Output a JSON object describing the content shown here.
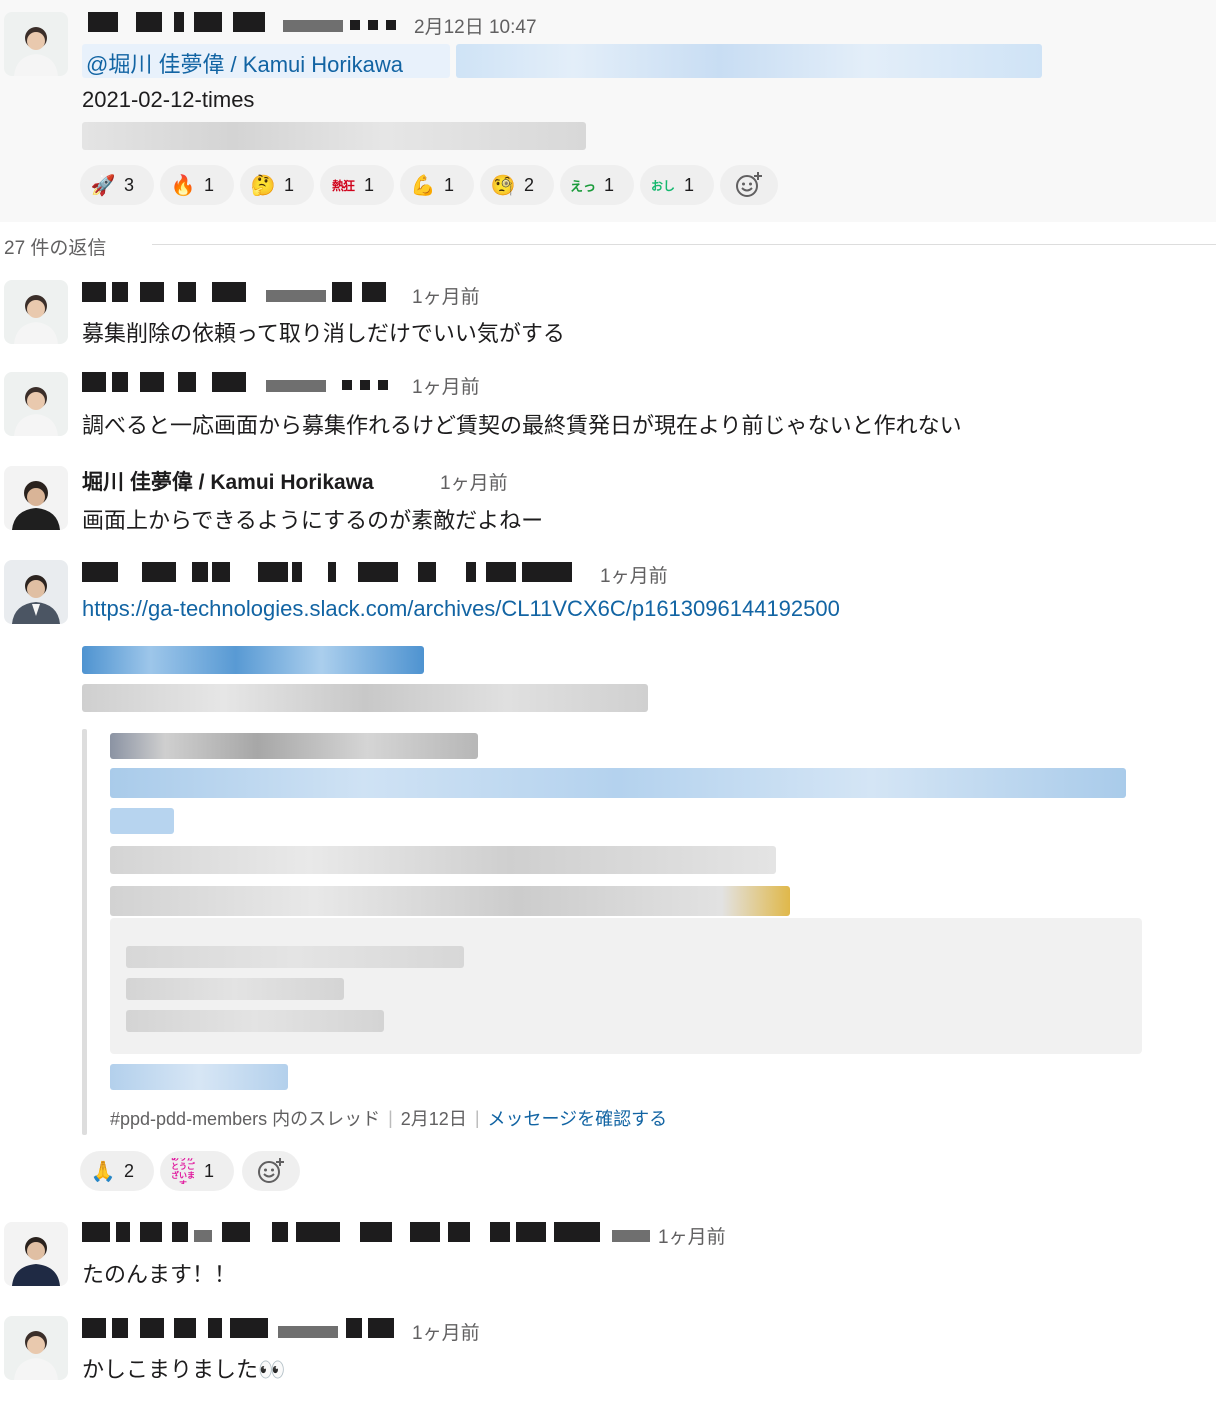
{
  "parent": {
    "timestamp": "2月12日 10:47",
    "mention": "@堀川 佳夢偉 / Kamui Horikawa",
    "title": "2021-02-12-times",
    "reactions": [
      {
        "emoji": "🚀",
        "count": "3"
      },
      {
        "emoji": "🔥",
        "count": "1"
      },
      {
        "emoji": "🤔",
        "count": "1"
      },
      {
        "emoji": "熱狂",
        "count": "1"
      },
      {
        "emoji": "💪",
        "count": "1"
      },
      {
        "emoji": "🧐",
        "count": "2"
      },
      {
        "emoji": "えっ",
        "count": "1"
      },
      {
        "emoji": "おし",
        "count": "1"
      }
    ]
  },
  "thread": {
    "reply_count_label": "27 件の返信"
  },
  "replies": [
    {
      "timestamp": "1ヶ月前",
      "text": "募集削除の依頼って取り消しだけでいい気がする"
    },
    {
      "timestamp": "1ヶ月前",
      "text": "調べると一応画面から募集作れるけど賃契の最終賃発日が現在より前じゃないと作れない"
    },
    {
      "author": "堀川 佳夢偉 / Kamui Horikawa",
      "timestamp": "1ヶ月前",
      "text": "画面上からできるようにするのが素敵だよねー"
    },
    {
      "timestamp": "1ヶ月前",
      "link": "https://ga-technologies.slack.com/archives/CL11VCX6C/p1613096144192500"
    },
    {
      "timestamp": "1ヶ月前",
      "text": "たのんます！！"
    },
    {
      "timestamp": "1ヶ月前",
      "text": "かしこまりました👀"
    }
  ],
  "shared_message": {
    "channel": "#ppd-pdd-members 内のスレッド",
    "date": "2月12日",
    "view_link": "メッセージを確認する"
  },
  "link_reactions": [
    {
      "emoji": "🙏",
      "count": "2"
    },
    {
      "emoji": "ありがとうございます",
      "count": "1"
    }
  ],
  "colors": {
    "link": "#1264a3",
    "parent_bg": "#f8f8f8",
    "reaction_bg": "#efefef"
  }
}
